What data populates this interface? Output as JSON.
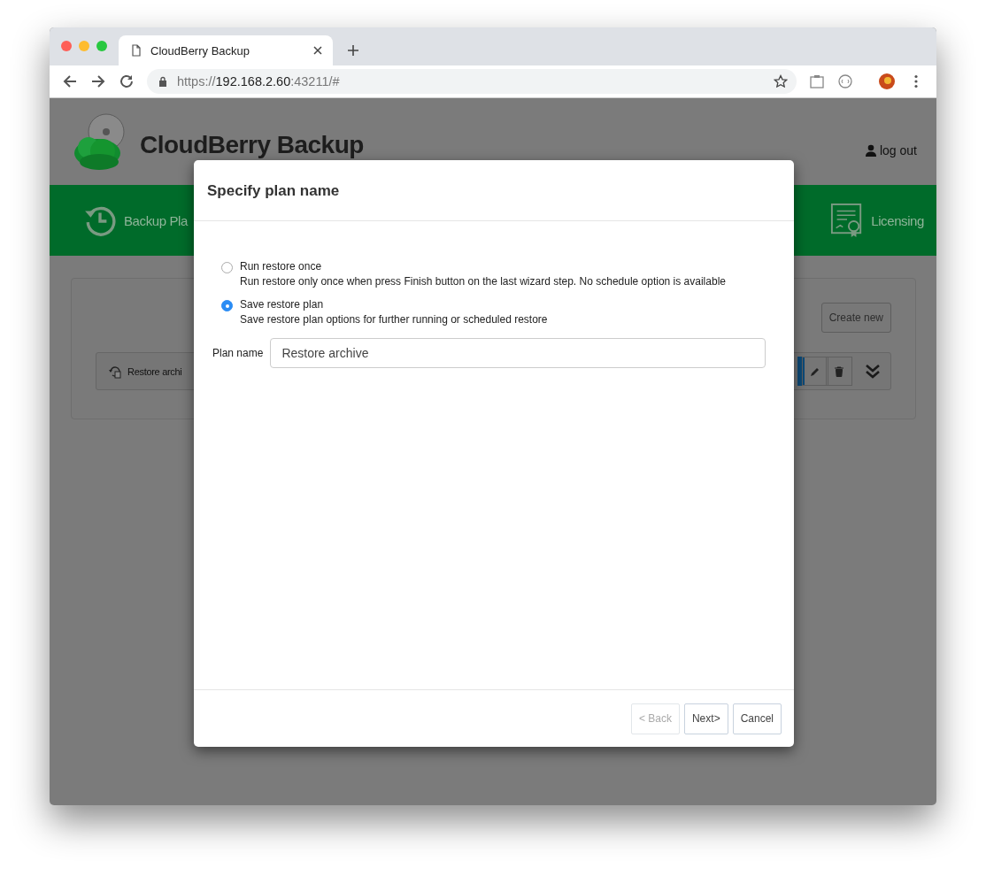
{
  "browser": {
    "tab_title": "CloudBerry Backup",
    "url": {
      "scheme": "https://",
      "host": "192.168.2.60",
      "rest": ":43211/#"
    }
  },
  "app": {
    "title": "CloudBerry Backup",
    "logout": "log out",
    "nav": [
      {
        "label": "Backup Pla",
        "kind": "history"
      },
      {
        "label": "Licensing",
        "kind": "certificate"
      }
    ],
    "create_button": "Create new",
    "plan_row": {
      "name": "Restore archi"
    }
  },
  "modal": {
    "title": "Specify plan name",
    "options": [
      {
        "label": "Run restore once",
        "description": "Run restore only once when press Finish button on the last wizard step. No schedule option is available",
        "selected": false
      },
      {
        "label": "Save restore plan",
        "description": "Save restore plan options for further running or scheduled restore",
        "selected": true
      }
    ],
    "plan_name": {
      "label": "Plan name",
      "value": "Restore archive"
    },
    "buttons": [
      {
        "label": "< Back",
        "disabled": true
      },
      {
        "label": "Next>",
        "disabled": false
      },
      {
        "label": "Cancel",
        "disabled": false
      }
    ]
  }
}
